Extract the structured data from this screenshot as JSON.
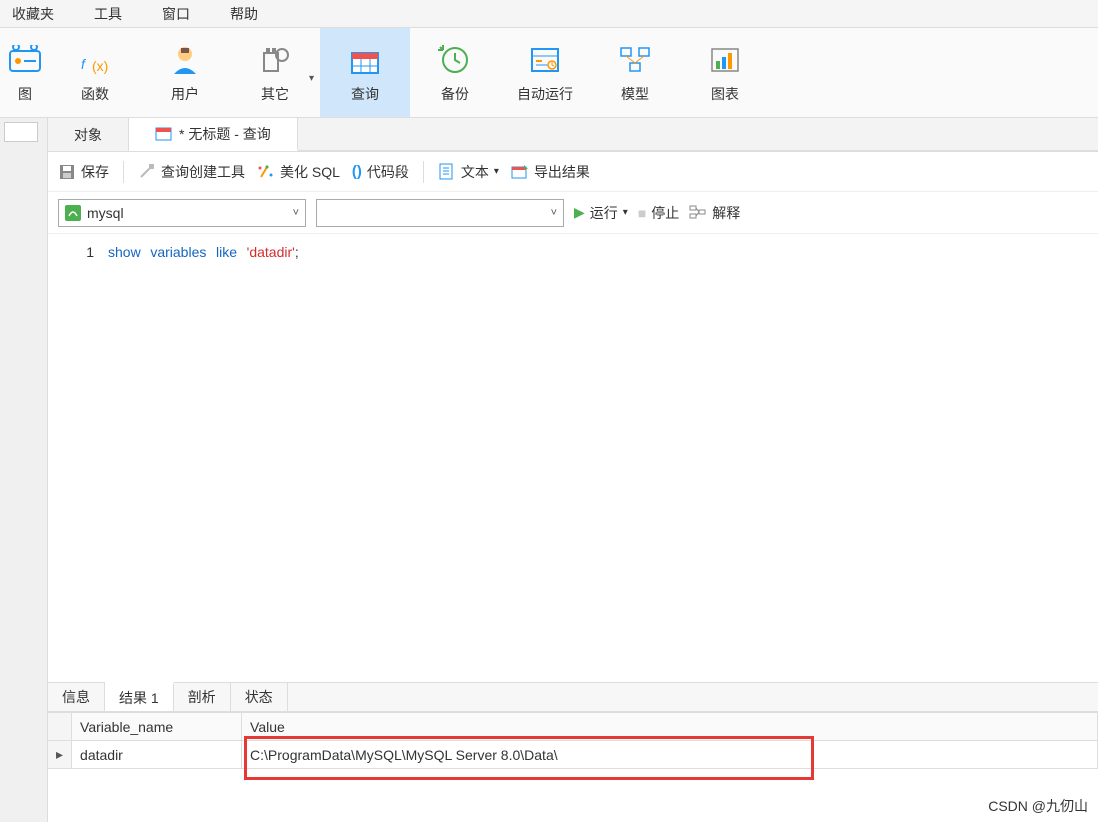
{
  "menu": {
    "favorites": "收藏夹",
    "tools": "工具",
    "window": "窗口",
    "help": "帮助"
  },
  "ribbon": {
    "view": "图",
    "function": "函数",
    "user": "用户",
    "other": "其它",
    "query": "查询",
    "backup": "备份",
    "autorun": "自动运行",
    "model": "模型",
    "chart": "图表"
  },
  "tabs": {
    "objects": "对象",
    "query_tab": "* 无标题 - 查询"
  },
  "toolbar": {
    "save": "保存",
    "builder": "查询创建工具",
    "beautify": "美化 SQL",
    "snippet": "代码段",
    "text": "文本",
    "export": "导出结果"
  },
  "runbar": {
    "conn": "mysql",
    "db": "",
    "run": "运行",
    "stop": "停止",
    "explain": "解释"
  },
  "editor": {
    "line_no": "1",
    "kw1": "show",
    "kw2": "variables",
    "kw3": "like",
    "str": "'datadir'",
    "semi": ";"
  },
  "result_tabs": {
    "info": "信息",
    "result1": "结果 1",
    "profile": "剖析",
    "status": "状态"
  },
  "grid": {
    "col1": "Variable_name",
    "col2": "Value",
    "row1_col1": "datadir",
    "row1_col2": "C:\\ProgramData\\MySQL\\MySQL Server 8.0\\Data\\"
  },
  "watermark": "CSDN @九仞山",
  "dropdown_arrow": "▾",
  "row_marker": "▸"
}
